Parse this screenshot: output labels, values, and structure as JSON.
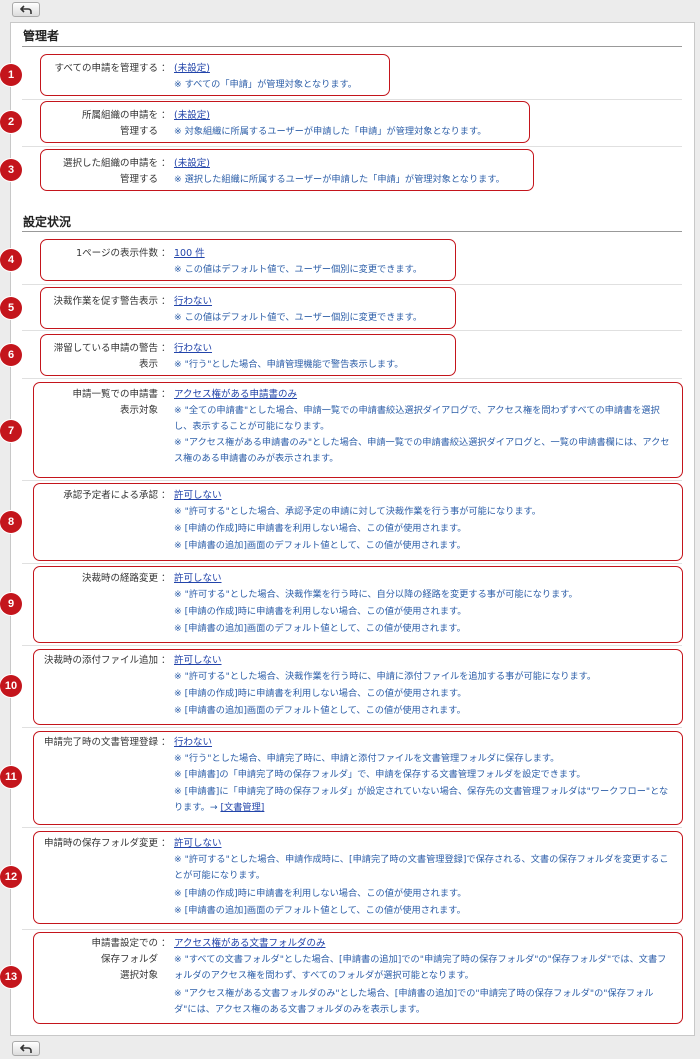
{
  "nav": {
    "back_icon": "back-arrow-icon"
  },
  "sections": {
    "admin": "管理者",
    "settings": "設定状況"
  },
  "items": [
    {
      "num": "1",
      "label1": "すべての申請を管理する",
      "label2": "",
      "colon": "：",
      "value": "(未設定)",
      "notes": [
        "※ すべての「申請」が管理対象となります。"
      ]
    },
    {
      "num": "2",
      "label1": "所属組織の申請を",
      "label2": "管理する",
      "colon": "：",
      "value": "(未設定)",
      "notes": [
        "※ 対象組織に所属するユーザーが申請した「申請」が管理対象となります。"
      ]
    },
    {
      "num": "3",
      "label1": "選択した組織の申請を",
      "label2": "管理する",
      "colon": "：",
      "value": "(未設定)",
      "notes": [
        "※ 選択した組織に所属するユーザーが申請した「申請」が管理対象となります。"
      ]
    },
    {
      "num": "4",
      "label1": "1ページの表示件数",
      "label2": "",
      "colon": "：",
      "value": "100 件",
      "notes": [
        "※ この値はデフォルト値で、ユーザー個別に変更できます。"
      ]
    },
    {
      "num": "5",
      "label1": "決裁作業を促す警告表示",
      "label2": "",
      "colon": "：",
      "value": "行わない",
      "notes": [
        "※ この値はデフォルト値で、ユーザー個別に変更できます。"
      ]
    },
    {
      "num": "6",
      "label1": "滞留している申請の警告",
      "label2": "表示",
      "colon": "：",
      "value": "行わない",
      "notes": [
        "※ \"行う\"とした場合、申請管理機能で警告表示します。"
      ]
    },
    {
      "num": "7",
      "label1": "申請一覧での申請書",
      "label2": "表示対象",
      "colon": "：",
      "value": "アクセス権がある申請書のみ",
      "notes": [
        "※ \"全ての申請書\"とした場合、申請一覧での申請書絞込選択ダイアログで、アクセス権を問わずすべての申請書を選択し、表示することが可能になります。",
        "※ \"アクセス権がある申請書のみ\"とした場合、申請一覧での申請書絞込選択ダイアログと、一覧の申請書欄には、アクセス権のある申請書のみが表示されます。"
      ]
    },
    {
      "num": "8",
      "label1": "承認予定者による承認",
      "label2": "",
      "colon": "：",
      "value": "許可しない",
      "notes": [
        "※ \"許可する\"とした場合、承認予定の申請に対して決裁作業を行う事が可能になります。",
        "※ [申請の作成]時に申請書を利用しない場合、この値が使用されます。",
        "※ [申請書の追加]画面のデフォルト値として、この値が使用されます。"
      ]
    },
    {
      "num": "9",
      "label1": "決裁時の経路変更",
      "label2": "",
      "colon": "：",
      "value": "許可しない",
      "notes": [
        "※ \"許可する\"とした場合、決裁作業を行う時に、自分以降の経路を変更する事が可能になります。",
        "※ [申請の作成]時に申請書を利用しない場合、この値が使用されます。",
        "※ [申請書の追加]画面のデフォルト値として、この値が使用されます。"
      ]
    },
    {
      "num": "10",
      "label1": "決裁時の添付ファイル追加",
      "label2": "",
      "colon": "：",
      "value": "許可しない",
      "notes": [
        "※ \"許可する\"とした場合、決裁作業を行う時に、申請に添付ファイルを追加する事が可能になります。",
        "※ [申請の作成]時に申請書を利用しない場合、この値が使用されます。",
        "※ [申請書の追加]画面のデフォルト値として、この値が使用されます。"
      ]
    },
    {
      "num": "11",
      "label1": "申請完了時の文書管理登録",
      "label2": "",
      "colon": "：",
      "value": "行わない",
      "notes": [
        "※ \"行う\"とした場合、申請完了時に、申請と添付ファイルを文書管理フォルダに保存します。",
        "※ [申請書]の「申請完了時の保存フォルダ」で、申請を保存する文書管理フォルダを設定できます。",
        "※ [申請書]に「申請完了時の保存フォルダ」が設定されていない場合、保存先の文書管理フォルダは\"ワークフロー\"となります。→ "
      ],
      "link": "[文書管理]"
    },
    {
      "num": "12",
      "label1": "申請時の保存フォルダ変更",
      "label2": "",
      "colon": "：",
      "value": "許可しない",
      "notes": [
        "※ \"許可する\"とした場合、申請作成時に、[申請完了時の文書管理登録]で保存される、文書の保存フォルダを変更することが可能になります。",
        "※ [申請の作成]時に申請書を利用しない場合、この値が使用されます。",
        "※ [申請書の追加]画面のデフォルト値として、この値が使用されます。"
      ]
    },
    {
      "num": "13",
      "label1": "申請書設定での",
      "label2": "保存フォルダ",
      "label3": "選択対象",
      "colon": "：",
      "value": "アクセス権がある文書フォルダのみ",
      "notes": [
        "※ \"すべての文書フォルダ\"とした場合、[申請書の追加]での\"申請完了時の保存フォルダ\"の\"保存フォルダ\"では、文書フォルダのアクセス権を問わず、すべてのフォルダが選択可能となります。",
        "※ \"アクセス権がある文書フォルダのみ\"とした場合、[申請書の追加]での\"申請完了時の保存フォルダ\"の\"保存フォルダ\"には、アクセス権のある文書フォルダのみを表示します。"
      ]
    }
  ]
}
